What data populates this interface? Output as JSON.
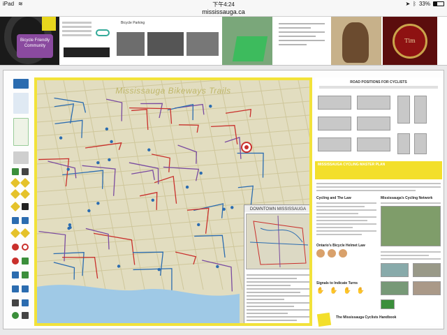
{
  "status_bar": {
    "device": "iPad",
    "time": "下午4:24",
    "battery": "33%",
    "battery_level": 0.33
  },
  "browser": {
    "url": "mississauga.ca"
  },
  "thumbnails": {
    "badge_text": "Bicycle Friendly Community",
    "tile_heading": "Bicycle Parking",
    "cup_text": "Tim Hortons"
  },
  "map": {
    "title": "Mississauga Bikeways Trails",
    "inset_title": "DOWNTOWN MISSISSAUGA"
  },
  "panel": {
    "road_positions": "ROAD POSITIONS FOR CYCLISTS",
    "master_plan": "MISSISSAUGA CYCLING MASTER PLAN",
    "cycling_law": "Cycling and The Law",
    "cycling_network": "Mississauga's Cycling Network",
    "helmet_law": "Ontario's Bicycle Helmet Law",
    "signals": "Signals to Indicate Turns",
    "handbook": "The Mississauga Cyclists Handbook"
  },
  "colors": {
    "map_border": "#f2e23a",
    "route_red": "#c9302c",
    "route_blue": "#2b6cb0",
    "route_purple": "#7a4ba0",
    "water": "#9fc9e6"
  }
}
